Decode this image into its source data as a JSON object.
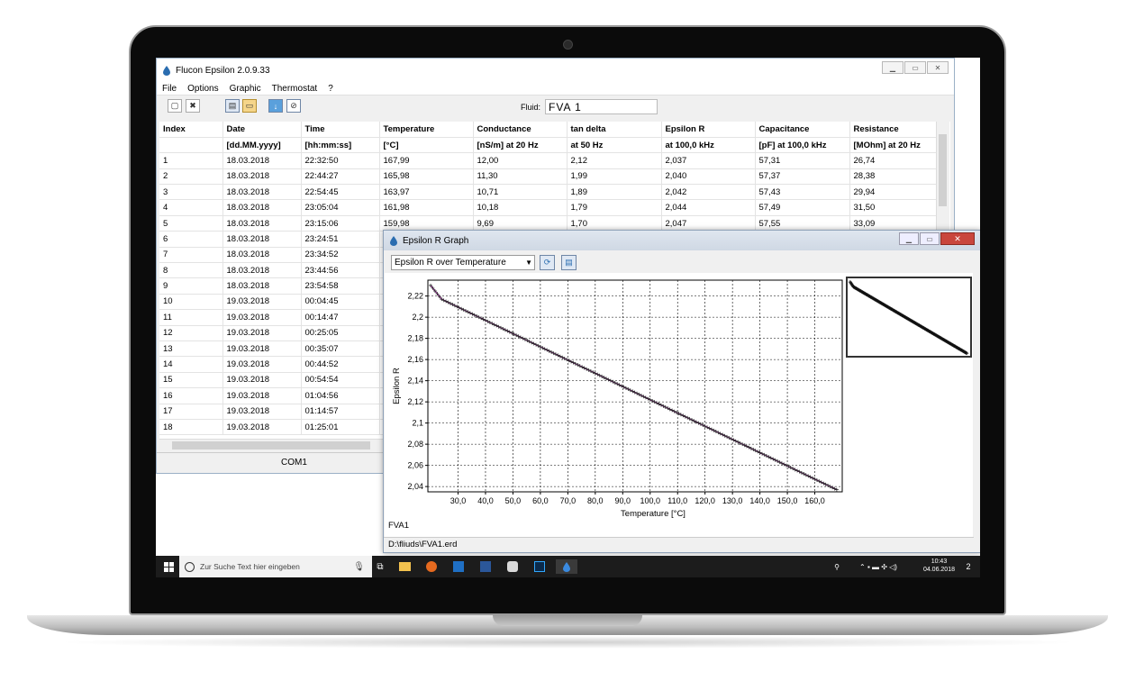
{
  "app": {
    "title": "Flucon Epsilon 2.0.9.33",
    "menu": [
      "File",
      "Options",
      "Graphic",
      "Thermostat",
      "?"
    ],
    "fluid_label": "Fluid:",
    "fluid_value": "FVA 1",
    "status_port": "COM1"
  },
  "table": {
    "headers": [
      "Index",
      "Date",
      "Time",
      "Temperature",
      "Conductance",
      "tan delta",
      "Epsilon R",
      "Capacitance",
      "Resistance"
    ],
    "units": [
      "",
      "[dd.MM.yyyy]",
      "[hh:mm:ss]",
      "[°C]",
      "[nS/m] at 20 Hz",
      "at 50 Hz",
      "at 100,0 kHz",
      "[pF] at 100,0 kHz",
      "[MOhm] at 20 Hz"
    ],
    "rows": [
      [
        "1",
        "18.03.2018",
        "22:32:50",
        "167,99",
        "12,00",
        "2,12",
        "2,037",
        "57,31",
        "26,74"
      ],
      [
        "2",
        "18.03.2018",
        "22:44:27",
        "165,98",
        "11,30",
        "1,99",
        "2,040",
        "57,37",
        "28,38"
      ],
      [
        "3",
        "18.03.2018",
        "22:54:45",
        "163,97",
        "10,71",
        "1,89",
        "2,042",
        "57,43",
        "29,94"
      ],
      [
        "4",
        "18.03.2018",
        "23:05:04",
        "161,98",
        "10,18",
        "1,79",
        "2,044",
        "57,49",
        "31,50"
      ],
      [
        "5",
        "18.03.2018",
        "23:15:06",
        "159,98",
        "9,69",
        "1,70",
        "2,047",
        "57,55",
        "33,09"
      ],
      [
        "6",
        "18.03.2018",
        "23:24:51",
        "",
        "",
        "",
        "",
        "",
        ""
      ],
      [
        "7",
        "18.03.2018",
        "23:34:52",
        "",
        "",
        "",
        "",
        "",
        ""
      ],
      [
        "8",
        "18.03.2018",
        "23:44:56",
        "",
        "",
        "",
        "",
        "",
        ""
      ],
      [
        "9",
        "18.03.2018",
        "23:54:58",
        "",
        "",
        "",
        "",
        "",
        ""
      ],
      [
        "10",
        "19.03.2018",
        "00:04:45",
        "",
        "",
        "",
        "",
        "",
        ""
      ],
      [
        "11",
        "19.03.2018",
        "00:14:47",
        "",
        "",
        "",
        "",
        "",
        ""
      ],
      [
        "12",
        "19.03.2018",
        "00:25:05",
        "",
        "",
        "",
        "",
        "",
        ""
      ],
      [
        "13",
        "19.03.2018",
        "00:35:07",
        "",
        "",
        "",
        "",
        "",
        ""
      ],
      [
        "14",
        "19.03.2018",
        "00:44:52",
        "",
        "",
        "",
        "",
        "",
        ""
      ],
      [
        "15",
        "19.03.2018",
        "00:54:54",
        "",
        "",
        "",
        "",
        "",
        ""
      ],
      [
        "16",
        "19.03.2018",
        "01:04:56",
        "",
        "",
        "",
        "",
        "",
        ""
      ],
      [
        "17",
        "19.03.2018",
        "01:14:57",
        "",
        "",
        "",
        "",
        "",
        ""
      ],
      [
        "18",
        "19.03.2018",
        "01:25:01",
        "",
        "",
        "",
        "",
        "",
        ""
      ]
    ]
  },
  "graph_window": {
    "title": "Epsilon R Graph",
    "selector": "Epsilon R over Temperature",
    "fluid_name": "FVA1",
    "file_path": "D:\\fliuds\\FVA1.erd"
  },
  "chart_data": {
    "type": "scatter",
    "xlabel": "Temperature [°C]",
    "ylabel": "Epsilon R",
    "xlim": [
      19,
      170
    ],
    "ylim": [
      2.035,
      2.235
    ],
    "x_ticks": [
      "30,0",
      "40,0",
      "50,0",
      "60,0",
      "70,0",
      "80,0",
      "90,0",
      "100,0",
      "110,0",
      "120,0",
      "130,0",
      "140,0",
      "150,0",
      "160,0"
    ],
    "y_ticks": [
      "2,22",
      "2,2",
      "2,18",
      "2,16",
      "2,14",
      "2,12",
      "2,1",
      "2,08",
      "2,06",
      "2,04"
    ],
    "grid": true,
    "series": [
      {
        "color": "#7a1f7a",
        "x": [
          168,
          164,
          160,
          156,
          152,
          148,
          144,
          140,
          136,
          132,
          128,
          124,
          120,
          116,
          112,
          108,
          104,
          100,
          96,
          92,
          88,
          84,
          80,
          76,
          72,
          68,
          64,
          60,
          56,
          52,
          48,
          44,
          40,
          36,
          32,
          28,
          24,
          20
        ],
        "y": [
          2.037,
          2.042,
          2.047,
          2.052,
          2.057,
          2.062,
          2.067,
          2.072,
          2.077,
          2.082,
          2.087,
          2.092,
          2.097,
          2.102,
          2.107,
          2.112,
          2.117,
          2.122,
          2.127,
          2.132,
          2.137,
          2.142,
          2.147,
          2.152,
          2.157,
          2.162,
          2.167,
          2.172,
          2.177,
          2.182,
          2.187,
          2.192,
          2.197,
          2.202,
          2.207,
          2.212,
          2.217,
          2.23
        ]
      }
    ]
  },
  "taskbar": {
    "search_placeholder": "Zur Suche Text hier eingeben",
    "clock_time": "10:43",
    "clock_date": "04.06.2018",
    "notification_count": "2"
  },
  "colors": {
    "accent": "#2a6db0",
    "series": "#7a1f7a",
    "close": "#c9463d",
    "taskbar": "#1c1c1c"
  }
}
